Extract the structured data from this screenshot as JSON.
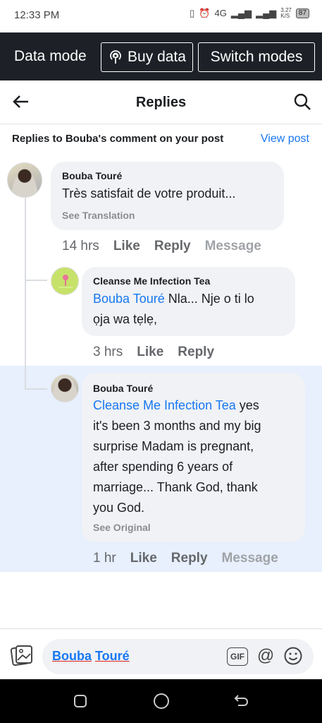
{
  "status_bar": {
    "time": "12:33 PM",
    "network_label": "4G",
    "speed_value": "3.27",
    "speed_unit": "K/S",
    "battery": "87"
  },
  "data_bar": {
    "title": "Data mode",
    "buy_data_label": "Buy data",
    "switch_modes_label": "Switch modes"
  },
  "header": {
    "title": "Replies"
  },
  "subheader": {
    "text": "Replies to Bouba's comment on your post",
    "view_post_label": "View post"
  },
  "comments": [
    {
      "author": "Bouba Touré",
      "mention": "",
      "text": "Très satisfait de votre produit...",
      "translation_link": "See Translation",
      "time": "14 hrs",
      "like_label": "Like",
      "reply_label": "Reply",
      "message_label": "Message"
    },
    {
      "author": "Cleanse Me Infection Tea",
      "mention": "Bouba Touré",
      "text_line1": " Nla... Nje o ti lo",
      "text_line2": "ọja wa tẹlẹ,",
      "time": "3 hrs",
      "like_label": "Like",
      "reply_label": "Reply"
    },
    {
      "author": "Bouba Touré",
      "mention": "Cleanse Me Infection Tea",
      "text_line1": " yes",
      "text_line2": "it's been 3 months and my big",
      "text_line3": "surprise Madam is pregnant,",
      "text_line4": "after spending 6 years of",
      "text_line5": "marriage... Thank God, thank",
      "text_line6": "you God.",
      "original_link": "See Original",
      "time": "1 hr",
      "like_label": "Like",
      "reply_label": "Reply",
      "message_label": "Message"
    }
  ],
  "composer": {
    "word1": "Bouba",
    "word2": "Touré",
    "gif_label": "GIF",
    "at_label": "@"
  },
  "colors": {
    "accent": "#1877f2",
    "data_bar_bg": "#1d2127",
    "highlight_bg": "#e7f0fc",
    "bubble_bg": "#f0f2f5"
  }
}
